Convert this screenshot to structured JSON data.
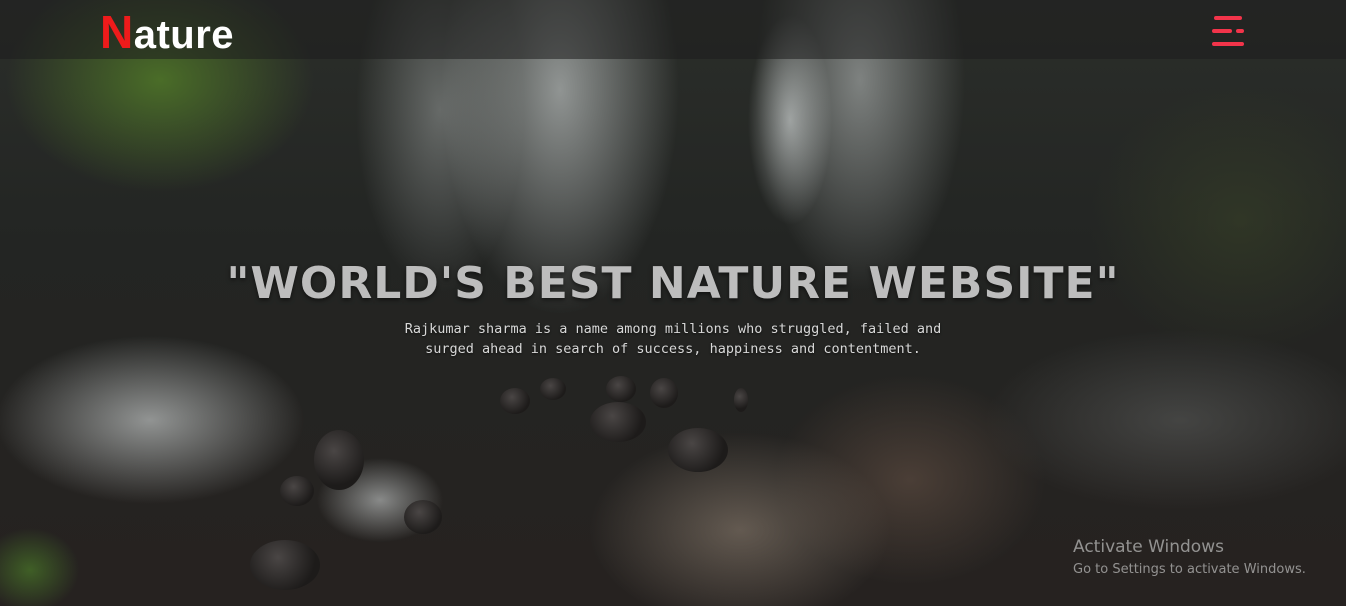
{
  "header": {
    "logo_first": "N",
    "logo_rest": "ature",
    "menu_icon": "hamburger-menu-icon"
  },
  "hero": {
    "headline": "\"WORLD'S BEST NATURE WEBSITE\"",
    "tagline_line1": "Rajkumar sharma is a name among millions who struggled, failed and",
    "tagline_line2": "surged ahead in search of success, happiness and contentment."
  },
  "watermark": {
    "title": "Activate Windows",
    "subtitle": "Go to Settings to activate Windows."
  },
  "colors": {
    "accent": "#ee1b1b",
    "menu": "#f2344a",
    "header_bg": "rgba(30,30,30,0.55)"
  }
}
